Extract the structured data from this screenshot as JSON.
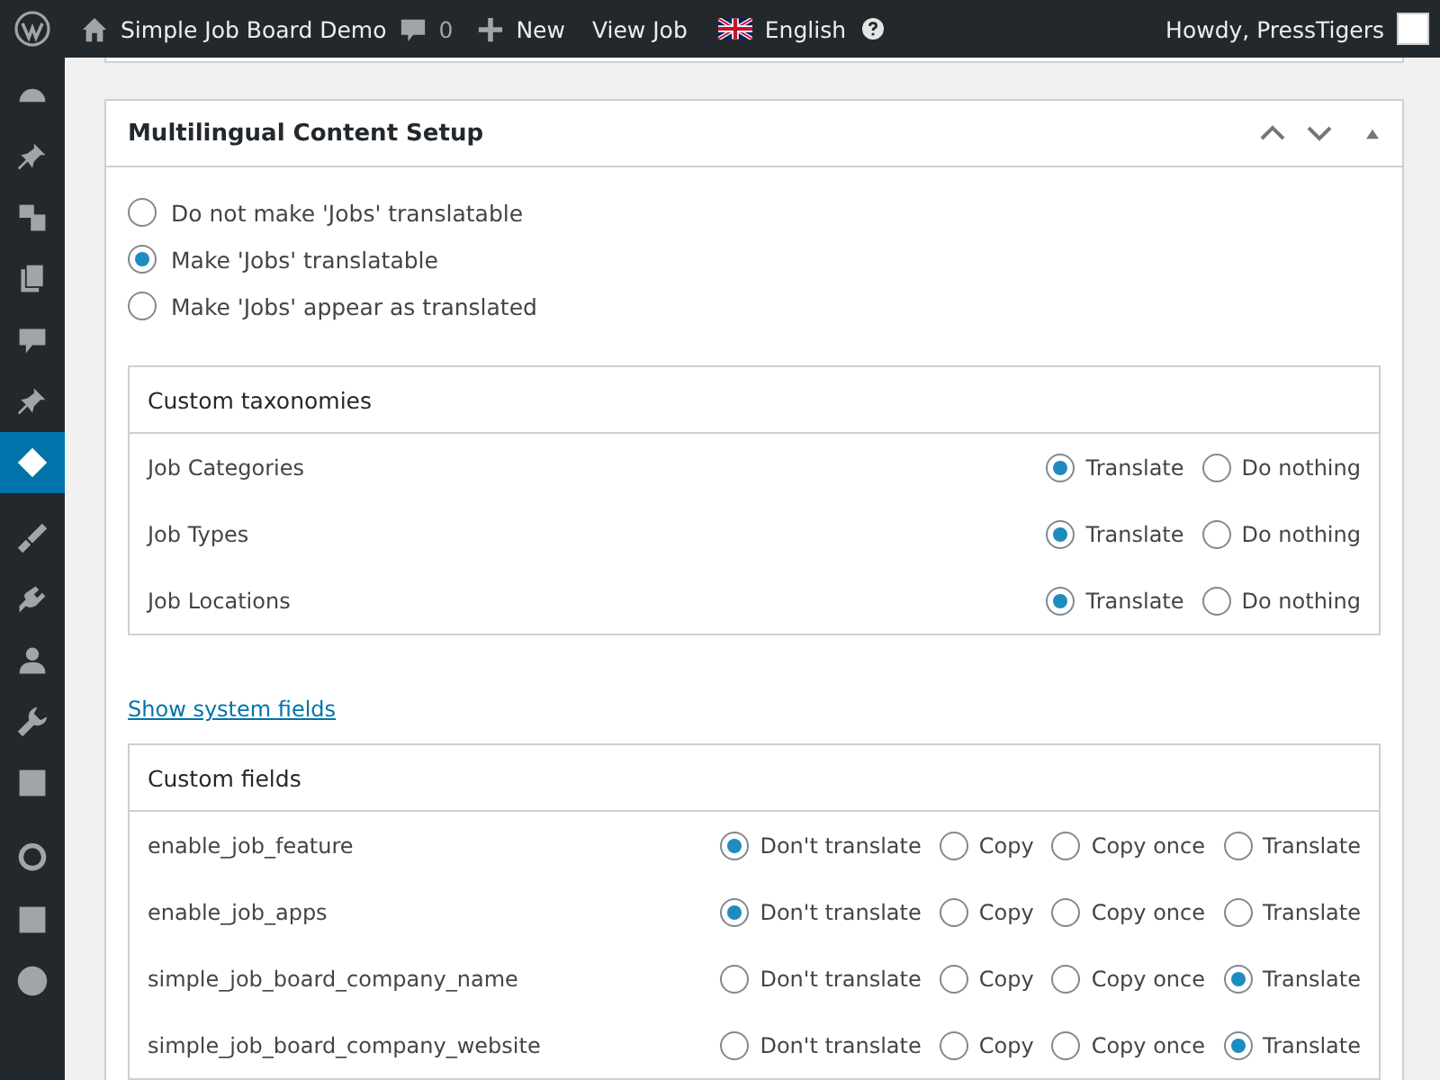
{
  "admin_bar": {
    "site_name": "Simple Job Board Demo",
    "comments_count": "0",
    "new_label": "New",
    "view_label": "View Job",
    "language": "English",
    "greeting": "Howdy, PressTigers"
  },
  "sidebar": {
    "items": [
      {
        "selected": false
      },
      {
        "selected": false
      },
      {
        "selected": false
      },
      {
        "selected": false
      },
      {
        "selected": false
      },
      {
        "selected": false
      },
      {
        "selected": true
      },
      {
        "selected": false
      },
      {
        "selected": false
      },
      {
        "selected": false
      },
      {
        "selected": false
      },
      {
        "selected": false
      },
      {
        "selected": false
      },
      {
        "selected": false
      },
      {
        "selected": false
      }
    ]
  },
  "panel": {
    "title": "Multilingual Content Setup",
    "mode_options": [
      {
        "label": "Do not make 'Jobs' translatable",
        "selected": false
      },
      {
        "label": "Make 'Jobs' translatable",
        "selected": true
      },
      {
        "label": "Make 'Jobs' appear as translated",
        "selected": false
      }
    ],
    "taxonomies": {
      "title": "Custom taxonomies",
      "rows": [
        {
          "name": "Job Categories",
          "options": [
            {
              "label": "Translate",
              "selected": true
            },
            {
              "label": "Do nothing",
              "selected": false
            }
          ]
        },
        {
          "name": "Job Types",
          "options": [
            {
              "label": "Translate",
              "selected": true
            },
            {
              "label": "Do nothing",
              "selected": false
            }
          ]
        },
        {
          "name": "Job Locations",
          "options": [
            {
              "label": "Translate",
              "selected": true
            },
            {
              "label": "Do nothing",
              "selected": false
            }
          ]
        }
      ]
    },
    "show_system_fields_link": "Show system fields",
    "custom_fields": {
      "title": "Custom fields",
      "rows": [
        {
          "name": "enable_job_feature",
          "options": [
            {
              "label": "Don't translate",
              "selected": true
            },
            {
              "label": "Copy",
              "selected": false
            },
            {
              "label": "Copy once",
              "selected": false
            },
            {
              "label": "Translate",
              "selected": false
            }
          ]
        },
        {
          "name": "enable_job_apps",
          "options": [
            {
              "label": "Don't translate",
              "selected": true
            },
            {
              "label": "Copy",
              "selected": false
            },
            {
              "label": "Copy once",
              "selected": false
            },
            {
              "label": "Translate",
              "selected": false
            }
          ]
        },
        {
          "name": "simple_job_board_company_name",
          "options": [
            {
              "label": "Don't translate",
              "selected": false
            },
            {
              "label": "Copy",
              "selected": false
            },
            {
              "label": "Copy once",
              "selected": false
            },
            {
              "label": "Translate",
              "selected": true
            }
          ]
        },
        {
          "name": "simple_job_board_company_website",
          "options": [
            {
              "label": "Don't translate",
              "selected": false
            },
            {
              "label": "Copy",
              "selected": false
            },
            {
              "label": "Copy once",
              "selected": false
            },
            {
              "label": "Translate",
              "selected": true
            }
          ]
        }
      ]
    }
  }
}
